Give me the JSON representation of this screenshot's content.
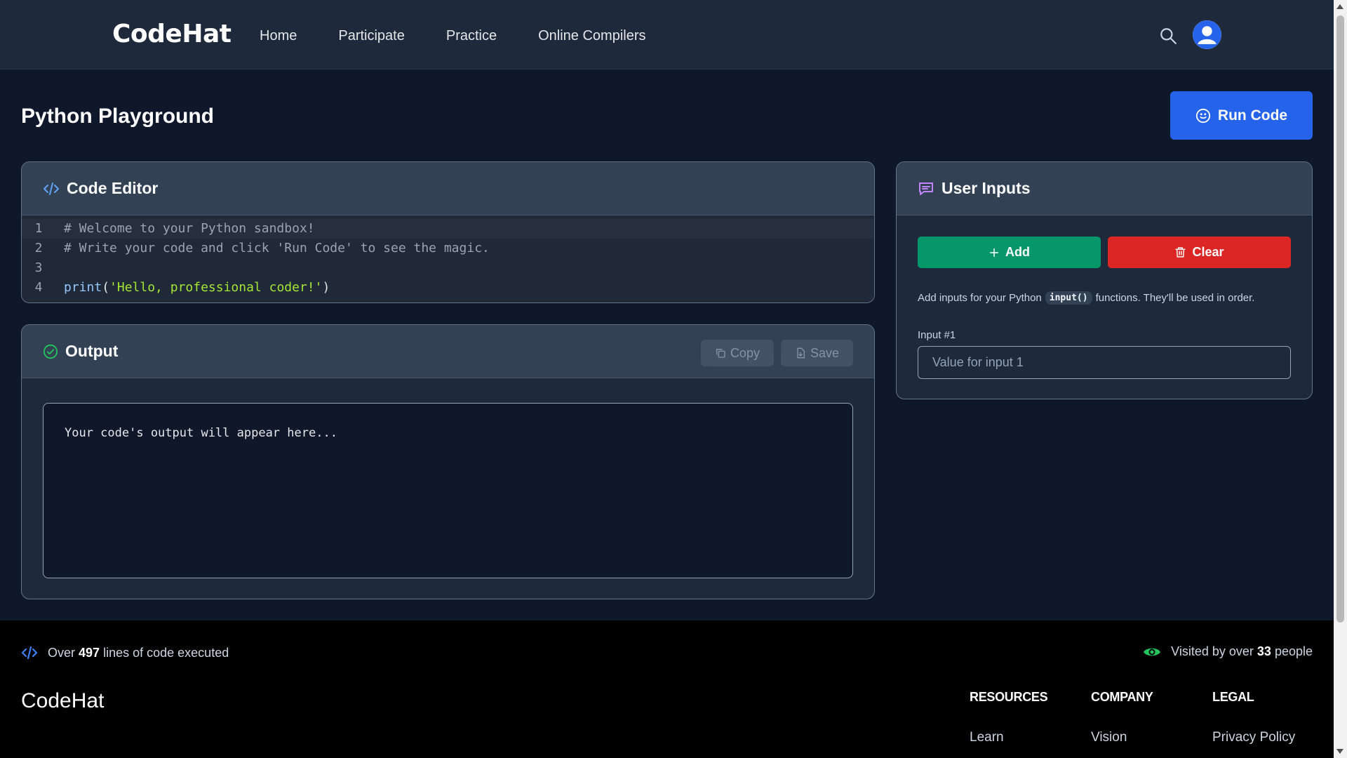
{
  "header": {
    "brand": "CodeHat",
    "nav": [
      "Home",
      "Participate",
      "Practice",
      "Online Compilers"
    ],
    "icons": [
      "search-icon",
      "user-avatar-icon"
    ]
  },
  "page": {
    "title": "Python Playground",
    "run_label": "Run Code"
  },
  "editor": {
    "title": "Code Editor",
    "lines": [
      {
        "num": "1",
        "text": "# Welcome to your Python sandbox!"
      },
      {
        "num": "2",
        "text": "# Write your code and click 'Run Code' to see the magic."
      },
      {
        "num": "3",
        "text": ""
      },
      {
        "num": "4",
        "fn": "print",
        "open": "(",
        "str": "'Hello, professional coder!'",
        "close": ")"
      }
    ]
  },
  "output": {
    "title": "Output",
    "copy_label": "Copy",
    "save_label": "Save",
    "placeholder": "Your code's output will appear here..."
  },
  "inputs": {
    "title": "User Inputs",
    "add_label": "Add",
    "clear_label": "Clear",
    "help_before": "Add inputs for your Python",
    "help_code": "input()",
    "help_after": "functions. They'll be used in order.",
    "field_label": "Input #1",
    "field_placeholder": "Value for input 1",
    "field_value": ""
  },
  "footer": {
    "stat_left_pre": "Over",
    "stat_left_num": "497",
    "stat_left_post": "lines of code executed",
    "stat_right_pre": "Visited by over",
    "stat_right_num": "33",
    "stat_right_post": "people",
    "brand": "CodeHat",
    "columns": [
      {
        "heading": "RESOURCES",
        "link": "Learn"
      },
      {
        "heading": "COMPANY",
        "link": "Vision"
      },
      {
        "heading": "LEGAL",
        "link": "Privacy Policy"
      }
    ]
  },
  "colors": {
    "accent": "#2563eb",
    "add": "#059669",
    "clear": "#dc2626",
    "success": "#22c55e",
    "header_bg": "#1e293b",
    "body_bg": "#0f172a"
  }
}
